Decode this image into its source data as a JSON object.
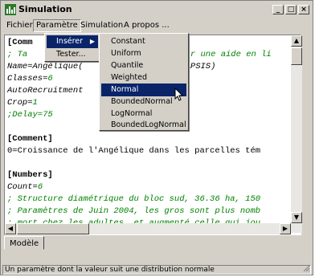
{
  "window": {
    "title": "Simulation",
    "icon": "app-icon",
    "controls": [
      "_",
      "□",
      "×"
    ]
  },
  "menubar": {
    "items": [
      "Fichier",
      "Paramètre",
      "Simulation",
      "A propos ..."
    ]
  },
  "param_menu": {
    "items": [
      "Insérer",
      "Tester..."
    ]
  },
  "insert_submenu": {
    "items": [
      "Constant",
      "Uniform",
      "Quantile",
      "Weighted",
      "Normal",
      "BoundedNormal",
      "LogNormal",
      "BoundedLogNormal"
    ],
    "highlighted": "Normal"
  },
  "editor": {
    "lines": [
      {
        "a": "[Comm",
        "b": ""
      },
      {
        "a": "; Ta",
        "b": "voir une aide en li"
      },
      {
        "a": "Name=Angélique(",
        "b": "(CAPSIS)"
      },
      {
        "a": "Classes=",
        "b": "6"
      },
      {
        "a": "AutoRecruitment",
        "b": ""
      },
      {
        "a": "Crop=",
        "b": "1"
      },
      {
        "a": ";Delay=75",
        "b": ""
      },
      {
        "a": "",
        "b": ""
      },
      {
        "a": "[Comment]",
        "b": ""
      },
      {
        "a": "0=Croissance de l'Angélique dans les parcelles tém",
        "b": ""
      },
      {
        "a": "",
        "b": ""
      },
      {
        "a": "[Numbers]",
        "b": ""
      },
      {
        "a": "Count=",
        "b": "6"
      },
      {
        "a": "; Structure diamétrique du bloc sud, 36.36 ha, 150",
        "b": ""
      },
      {
        "a": "; Paramètres de Juin 2004, les gros sont plus nomb",
        "b": ""
      },
      {
        "a": "; mort chez les adultes, et augmenté celle qui jou",
        "b": ""
      }
    ]
  },
  "tabs": {
    "active": "Modèle"
  },
  "status": {
    "text": "Un paramètre dont la valeur suit une distribution normale"
  },
  "colors": {
    "comment": "#008000",
    "highlight": "#0a246a",
    "chrome": "#d4d0c8"
  }
}
